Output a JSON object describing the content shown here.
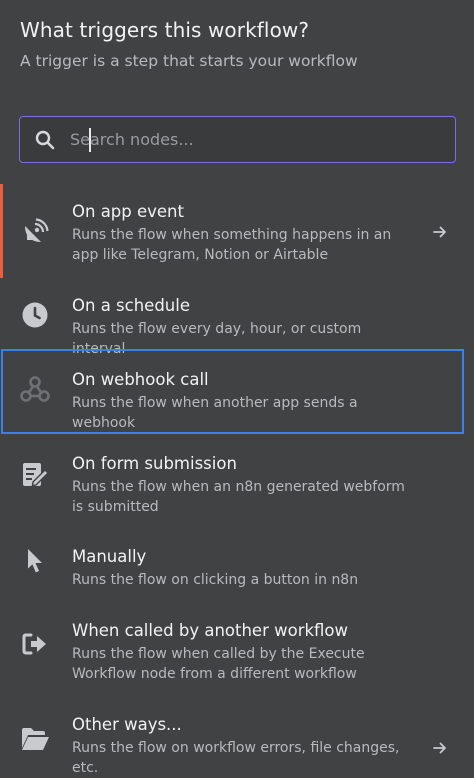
{
  "header": {
    "title": "What triggers this workflow?",
    "subtitle": "A trigger is a step that starts your workflow"
  },
  "search": {
    "placeholder": "Search nodes...",
    "value": ""
  },
  "triggers": [
    {
      "name": "On app event",
      "description": "Runs the flow when something happens in an app like Telegram, Notion or Airtable",
      "icon": "satellite-dish-icon",
      "has_arrow": true,
      "active_accent": true
    },
    {
      "name": "On a schedule",
      "description": "Runs the flow every day, hour, or custom interval",
      "icon": "clock-icon"
    },
    {
      "name": "On webhook call",
      "description": "Runs the flow when another app sends a webhook",
      "icon": "webhook-icon",
      "selected": true
    },
    {
      "name": "On form submission",
      "description": "Runs the flow when an n8n generated webform is submitted",
      "icon": "form-edit-icon"
    },
    {
      "name": "Manually",
      "description": "Runs the flow on clicking a button in n8n",
      "icon": "cursor-pointer-icon"
    },
    {
      "name": "When called by another workflow",
      "description": "Runs the flow when called by the Execute Workflow node from a different workflow",
      "icon": "sign-out-icon"
    },
    {
      "name": "Other ways...",
      "description": "Runs the flow on workflow errors, file changes, etc.",
      "icon": "folder-open-icon",
      "has_arrow": true
    }
  ],
  "colors": {
    "background": "#414244",
    "accent_bar": "#e85f42",
    "selection_border": "#3b82e6",
    "search_border": "#7a6fe0"
  }
}
